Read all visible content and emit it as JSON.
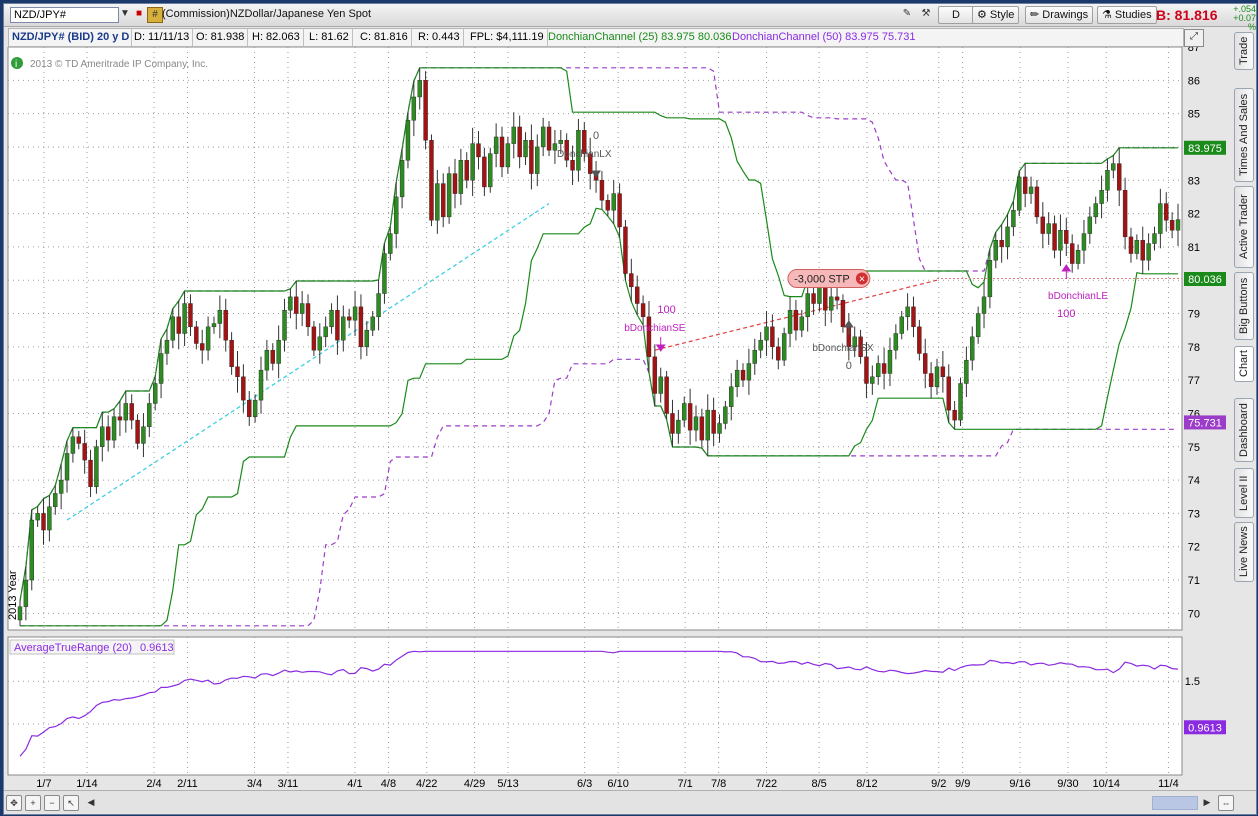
{
  "toolbar": {
    "symbol": "NZD/JPY#",
    "description": "(Commission)NZDollar/Japanese Yen Spot",
    "d_btn": "D",
    "style_btn": "Style",
    "drawings_btn": "Drawings",
    "studies_btn": "Studies",
    "bid": "B: 81.816",
    "change_abs": "+.054",
    "change_pct": "+0.07 %"
  },
  "info": {
    "instrument": "NZD/JPY# (BID) 20 y D",
    "date": "D: 11/11/13",
    "open": "O: 81.938",
    "high": "H: 82.063",
    "low": "L: 81.62",
    "close": "C: 81.816",
    "range": "R: 0.443",
    "fpl": "FPL: $4,111.19",
    "dc25": "DonchianChannel (25)",
    "dc25_u": "83.975",
    "dc25_l": "80.036",
    "dc50": "DonchianChannel (50)",
    "dc50_u": "83.975",
    "dc50_l": "75.731"
  },
  "copyright": "2013 © TD Ameritrade IP Company, Inc.",
  "sidebar": [
    "Trade",
    "Times And Sales",
    "Active Trader",
    "Big Buttons",
    "Chart",
    "Dashboard",
    "Level II",
    "Live News"
  ],
  "annotations": {
    "lx_qty": "0",
    "lx": "DonchianLX",
    "se_qty": "100",
    "se": "bDonchianSE",
    "sx": "bDonchianSX",
    "sx_qty": "0",
    "le": "bDonchianLE",
    "le_qty": "100",
    "stop": "-3,000 STP",
    "year": "2013 Year"
  },
  "lower_panel": {
    "name": "AverageTrueRange (20)",
    "value": "0.9613"
  },
  "colors": {
    "up": "#2e8b22",
    "down": "#a31313",
    "dc25": "#1a8a1a",
    "dc50": "#9b3dc9",
    "atr": "#8a2be2",
    "grid": "#9a9a9a",
    "trend": "#3cd0e0"
  },
  "chart_data": {
    "type": "candlestick",
    "price_axis": {
      "ticks": [
        70,
        71,
        72,
        73,
        74,
        75,
        76,
        77,
        78,
        79,
        80,
        81,
        82,
        83,
        84,
        85,
        86,
        87
      ]
    },
    "time_axis": {
      "ticks": [
        "1/7",
        "1/14",
        "2/4",
        "2/11",
        "3/4",
        "3/11",
        "4/1",
        "4/8",
        "4/22",
        "4/29",
        "5/13",
        "6/3",
        "6/10",
        "7/1",
        "7/8",
        "7/22",
        "8/5",
        "8/12",
        "9/2",
        "9/9",
        "9/16",
        "9/30",
        "10/14",
        "11/4"
      ]
    },
    "closes": [
      70.2,
      71.0,
      72.8,
      73.0,
      72.5,
      73.2,
      73.6,
      74.0,
      74.8,
      75.3,
      75.1,
      74.6,
      73.8,
      75.0,
      75.6,
      75.2,
      75.9,
      75.8,
      76.3,
      75.8,
      75.1,
      75.6,
      76.3,
      76.9,
      77.8,
      78.2,
      78.9,
      78.4,
      79.3,
      78.6,
      78.1,
      77.9,
      78.6,
      78.7,
      79.1,
      78.2,
      77.4,
      77.1,
      76.4,
      75.9,
      76.4,
      77.3,
      77.9,
      77.5,
      78.2,
      79.1,
      79.5,
      79.0,
      79.3,
      78.6,
      77.9,
      78.3,
      78.6,
      79.1,
      78.2,
      78.9,
      78.8,
      79.2,
      78.0,
      78.5,
      78.9,
      79.6,
      80.8,
      81.4,
      82.5,
      83.6,
      84.8,
      85.5,
      86.0,
      84.2,
      81.8,
      82.9,
      81.9,
      83.2,
      82.6,
      83.6,
      83.0,
      84.1,
      83.7,
      82.8,
      83.8,
      84.3,
      83.4,
      84.1,
      84.6,
      83.7,
      84.2,
      83.2,
      84.0,
      84.6,
      83.9,
      84.1,
      84.2,
      83.6,
      83.3,
      84.5,
      83.8,
      83.2,
      83.0,
      82.4,
      82.1,
      82.6,
      81.6,
      80.2,
      79.8,
      79.3,
      78.9,
      77.7,
      76.6,
      77.1,
      76.0,
      75.4,
      75.8,
      76.3,
      75.5,
      75.9,
      75.2,
      76.1,
      75.4,
      75.7,
      76.2,
      76.8,
      77.3,
      77.0,
      77.5,
      77.9,
      78.2,
      78.6,
      78.0,
      77.6,
      78.4,
      79.1,
      78.5,
      78.9,
      79.6,
      79.3,
      79.8,
      79.1,
      79.5,
      79.4,
      78.6,
      78.0,
      78.3,
      77.7,
      76.9,
      77.1,
      77.5,
      77.2,
      77.9,
      78.4,
      78.9,
      79.2,
      78.6,
      77.8,
      77.2,
      76.8,
      77.4,
      77.1,
      76.1,
      75.8,
      76.9,
      77.6,
      78.3,
      79.0,
      79.5,
      80.6,
      81.2,
      81.0,
      81.6,
      82.1,
      83.1,
      82.6,
      82.8,
      81.9,
      81.4,
      81.7,
      80.9,
      81.5,
      81.1,
      80.5,
      80.9,
      81.4,
      81.9,
      82.3,
      82.7,
      83.3,
      83.5,
      82.7,
      81.3,
      80.8,
      81.2,
      80.6,
      81.1,
      81.4,
      82.3,
      81.8,
      81.5,
      81.82
    ]
  }
}
